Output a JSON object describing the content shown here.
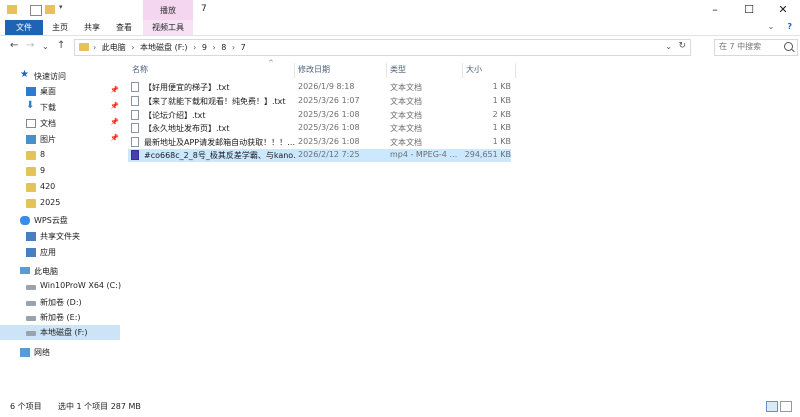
{
  "window": {
    "title": "7",
    "contextual_tab_group": "播放",
    "controls": {
      "minimize": "–",
      "maximize": "☐",
      "close": "✕"
    }
  },
  "ribbon": {
    "tabs": [
      {
        "label": "文件"
      },
      {
        "label": "主页"
      },
      {
        "label": "共享"
      },
      {
        "label": "查看"
      },
      {
        "label": "视频工具"
      }
    ],
    "expand": "⌄",
    "help": "?"
  },
  "address": {
    "back": "←",
    "forward": "→",
    "recent": "⌄",
    "up": "↑",
    "crumbs": [
      "此电脑",
      "本地磁盘 (F:)",
      "9",
      "8",
      "7"
    ],
    "separator": "›",
    "dropdown": "⌄",
    "refresh": "↻"
  },
  "search": {
    "placeholder": "在 7 中搜索"
  },
  "nav": {
    "quick_access": "快速访问",
    "items_quick": [
      {
        "label": "桌面",
        "icon": "desktop-icon",
        "pinned": true
      },
      {
        "label": "下载",
        "icon": "download-icon",
        "pinned": true
      },
      {
        "label": "文档",
        "icon": "document-icon",
        "pinned": true
      },
      {
        "label": "图片",
        "icon": "picture-icon",
        "pinned": true
      },
      {
        "label": "8",
        "icon": "folder-icon"
      },
      {
        "label": "9",
        "icon": "folder-icon"
      },
      {
        "label": "420",
        "icon": "folder-icon"
      },
      {
        "label": "2025",
        "icon": "folder-icon"
      }
    ],
    "wps": "WPS云盘",
    "wps_items": [
      {
        "label": "共享文件夹",
        "icon": "shared-folder-icon"
      },
      {
        "label": "应用",
        "icon": "apps-icon"
      }
    ],
    "this_pc": "此电脑",
    "drives": [
      {
        "label": "Win10ProW X64 (C:)"
      },
      {
        "label": "新加卷 (D:)"
      },
      {
        "label": "新加卷 (E:)"
      },
      {
        "label": "本地磁盘 (F:)",
        "selected": true
      }
    ],
    "network": "网络"
  },
  "columns": {
    "name": "名称",
    "date": "修改日期",
    "type": "类型",
    "size": "大小"
  },
  "files": [
    {
      "name": "【好用便宜的梯子】.txt",
      "date": "2026/1/9 8:18",
      "type": "文本文档",
      "size": "1 KB",
      "kind": "text"
    },
    {
      "name": "【来了就能下载和观看！纯免费！】.txt",
      "date": "2025/3/26 1:07",
      "type": "文本文档",
      "size": "1 KB",
      "kind": "text"
    },
    {
      "name": "【论坛介绍】.txt",
      "date": "2025/3/26 1:08",
      "type": "文本文档",
      "size": "2 KB",
      "kind": "text"
    },
    {
      "name": "【永久地址发布页】.txt",
      "date": "2025/3/26 1:08",
      "type": "文本文档",
      "size": "1 KB",
      "kind": "text"
    },
    {
      "name": "最新地址及APP请发邮箱自动获取！！！…",
      "date": "2025/3/26 1:08",
      "type": "文本文档",
      "size": "1 KB",
      "kind": "text"
    },
    {
      "name": "#co668c_2_8号_极其反差学霸、与kano…",
      "date": "2026/2/12 7:25",
      "type": "mp4 - MPEG-4 …",
      "size": "294,651 KB",
      "kind": "video",
      "selected": true
    }
  ],
  "status": {
    "count": "6 个项目",
    "selected": "选中 1 个项目  287 MB"
  }
}
